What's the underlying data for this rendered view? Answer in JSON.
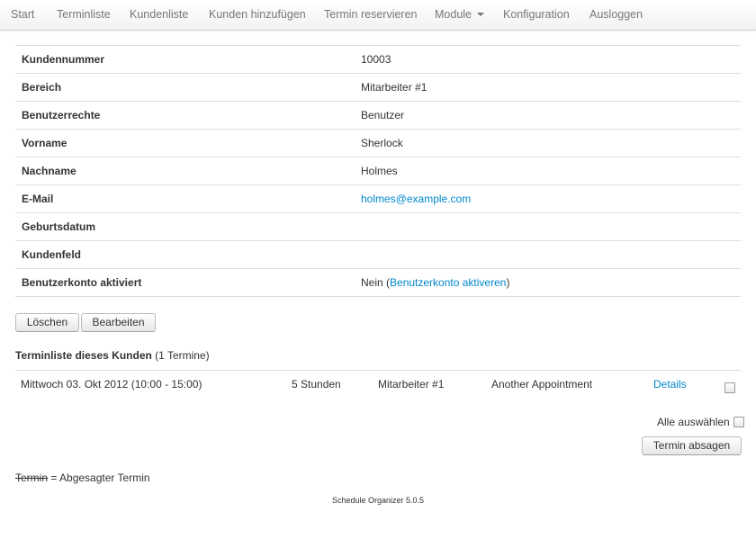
{
  "nav": {
    "items": [
      "Start",
      "Terminliste",
      "Kundenliste",
      "Kunden hinzufügen",
      "Termin reservieren",
      "Module",
      "Konfiguration",
      "Ausloggen"
    ]
  },
  "details": [
    {
      "label": "Kundennummer",
      "value": "10003"
    },
    {
      "label": "Bereich",
      "value": "Mitarbeiter #1"
    },
    {
      "label": "Benutzerrechte",
      "value": "Benutzer"
    },
    {
      "label": "Vorname",
      "value": "Sherlock"
    },
    {
      "label": "Nachname",
      "value": "Holmes"
    },
    {
      "label": "E-Mail",
      "value": "holmes@example.com"
    },
    {
      "label": "Geburtsdatum",
      "value": ""
    },
    {
      "label": "Kundenfeld",
      "value": ""
    },
    {
      "label": "Benutzerkonto aktiviert",
      "value_prefix": "Nein (",
      "value_link": "Benutzerkonto aktiveren",
      "value_suffix": ")"
    }
  ],
  "actions": {
    "delete_label": "Löschen",
    "edit_label": "Bearbeiten"
  },
  "appointments_section": {
    "title": "Terminliste dieses Kunden",
    "count": "(1 Termine)"
  },
  "appointments": [
    {
      "date": "Mittwoch 03. Okt 2012 (10:00 - 15:00)",
      "duration": "5 Stunden",
      "staff": "Mitarbeiter #1",
      "title": "Another Appointment",
      "details_label": "Details"
    }
  ],
  "select_all_label": "Alle auswählen",
  "cancel_button_label": "Termin absagen",
  "legend": {
    "struck_word": "Termin",
    "text": " = Abgesagter Termin"
  },
  "footer": "Schedule Organizer 5.0.5",
  "colors": {
    "link": "#0088cc",
    "nav_text": "#777777",
    "border": "#dddddd"
  }
}
